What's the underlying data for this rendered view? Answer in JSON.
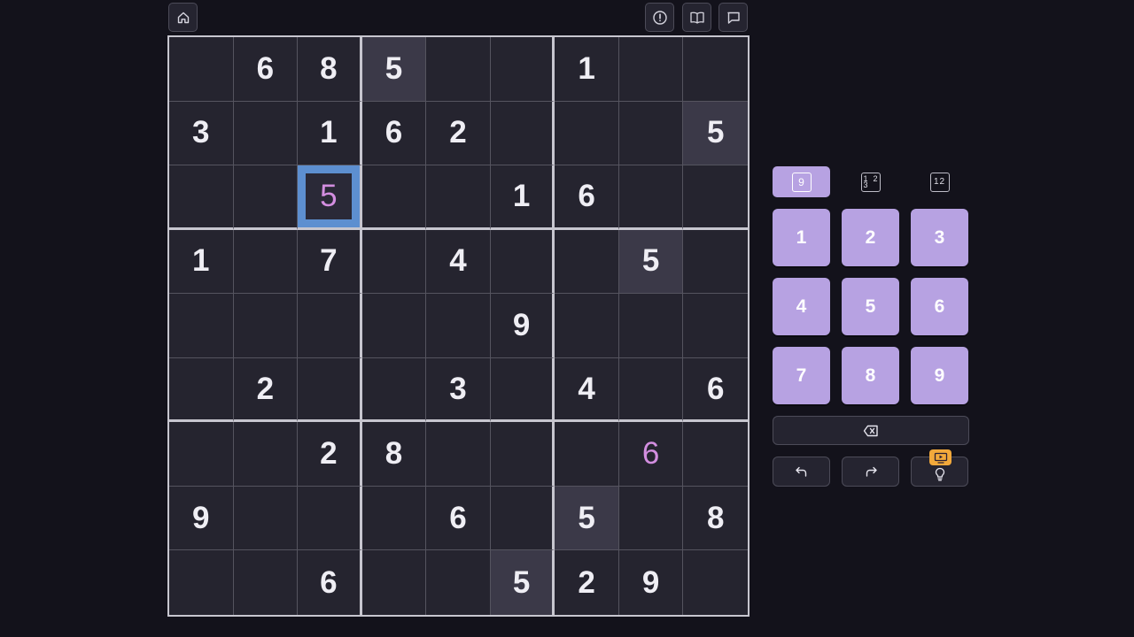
{
  "toolbar": {
    "left": [
      {
        "name": "home-button",
        "icon": "home-icon"
      }
    ],
    "right": [
      {
        "name": "report-button",
        "icon": "alert-circle-icon"
      },
      {
        "name": "rules-button",
        "icon": "book-open-icon"
      },
      {
        "name": "feedback-button",
        "icon": "message-square-icon"
      }
    ]
  },
  "board": {
    "grid": [
      [
        "",
        "6",
        "8",
        "5",
        "",
        "",
        "1",
        "",
        ""
      ],
      [
        "3",
        "",
        "1",
        "6",
        "2",
        "",
        "",
        "",
        "5"
      ],
      [
        "",
        "",
        "5",
        "",
        "",
        "1",
        "6",
        "",
        ""
      ],
      [
        "1",
        "",
        "7",
        "",
        "4",
        "",
        "",
        "5",
        ""
      ],
      [
        "",
        "",
        "",
        "",
        "",
        "9",
        "",
        "",
        ""
      ],
      [
        "",
        "2",
        "",
        "",
        "3",
        "",
        "4",
        "",
        "6"
      ],
      [
        "",
        "",
        "2",
        "8",
        "",
        "",
        "",
        "6",
        ""
      ],
      [
        "9",
        "",
        "",
        "",
        "6",
        "",
        "5",
        "",
        "8"
      ],
      [
        "",
        "",
        "6",
        "",
        "",
        "5",
        "2",
        "9",
        ""
      ]
    ],
    "selected": [
      2,
      2
    ],
    "user_entries": [
      [
        2,
        2
      ],
      [
        6,
        7
      ]
    ],
    "highlighted": [
      [
        0,
        3
      ],
      [
        1,
        8
      ],
      [
        3,
        7
      ],
      [
        7,
        6
      ],
      [
        8,
        5
      ]
    ],
    "colors": {
      "user_digit": "#d38ee0",
      "selected_border": "#5d8fd0",
      "highlight": "#3b3948"
    }
  },
  "input_modes": [
    {
      "name": "digit-mode",
      "label": "9",
      "active": true
    },
    {
      "name": "corner-mode",
      "labels": [
        "1",
        "2",
        "3"
      ],
      "active": false
    },
    {
      "name": "center-mode",
      "label": "12",
      "active": false
    }
  ],
  "numpad": {
    "keys": [
      "1",
      "2",
      "3",
      "4",
      "5",
      "6",
      "7",
      "8",
      "9"
    ],
    "color": "#b7a2e2"
  },
  "actions": {
    "erase": {
      "icon": "backspace-icon"
    },
    "undo": {
      "icon": "undo-icon"
    },
    "redo": {
      "icon": "redo-icon"
    },
    "hint": {
      "icon": "lightbulb-icon",
      "badge_icon": "video-ad-icon",
      "badge_color": "#f2a93b"
    }
  }
}
